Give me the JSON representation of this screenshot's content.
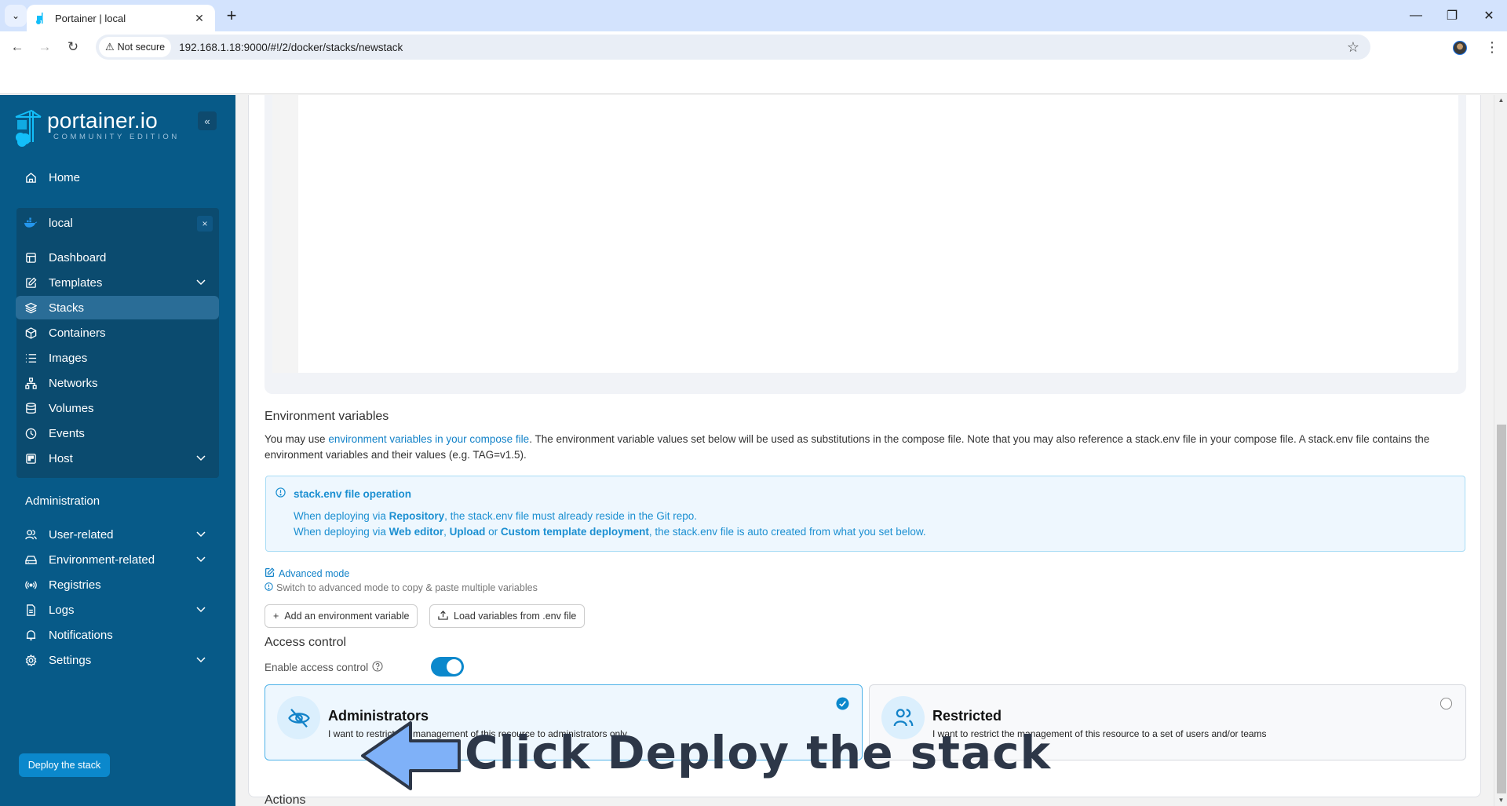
{
  "browser": {
    "tab_title": "Portainer | local",
    "new_tab": "+",
    "security_chip": "Not secure",
    "url": "192.168.1.18:9000/#!/2/docker/stacks/newstack"
  },
  "sidebar": {
    "logo_main": "portainer.io",
    "logo_sub": "COMMUNITY EDITION",
    "collapse": "«",
    "home": "Home",
    "environment": {
      "name": "local",
      "close": "×",
      "items": [
        {
          "label": "Dashboard",
          "icon": "dashboard-icon",
          "expandable": false,
          "active": false
        },
        {
          "label": "Templates",
          "icon": "edit-icon",
          "expandable": true,
          "active": false
        },
        {
          "label": "Stacks",
          "icon": "layers-icon",
          "expandable": false,
          "active": true
        },
        {
          "label": "Containers",
          "icon": "box-icon",
          "expandable": false,
          "active": false
        },
        {
          "label": "Images",
          "icon": "list-icon",
          "expandable": false,
          "active": false
        },
        {
          "label": "Networks",
          "icon": "network-icon",
          "expandable": false,
          "active": false
        },
        {
          "label": "Volumes",
          "icon": "database-icon",
          "expandable": false,
          "active": false
        },
        {
          "label": "Events",
          "icon": "clock-icon",
          "expandable": false,
          "active": false
        },
        {
          "label": "Host",
          "icon": "host-icon",
          "expandable": true,
          "active": false
        }
      ]
    },
    "administration": {
      "title": "Administration",
      "items": [
        {
          "label": "User-related",
          "icon": "users-icon",
          "expandable": true
        },
        {
          "label": "Environment-related",
          "icon": "hard-drive-icon",
          "expandable": true
        },
        {
          "label": "Registries",
          "icon": "radio-icon",
          "expandable": false
        },
        {
          "label": "Logs",
          "icon": "file-text-icon",
          "expandable": true
        },
        {
          "label": "Notifications",
          "icon": "bell-icon",
          "expandable": false
        },
        {
          "label": "Settings",
          "icon": "gear-icon",
          "expandable": true
        }
      ]
    }
  },
  "env_vars": {
    "title": "Environment variables",
    "desc_prefix": "You may use ",
    "desc_link": "environment variables in your compose file",
    "desc_suffix": ". The environment variable values set below will be used as substitutions in the compose file. Note that you may also reference a stack.env file in your compose file. A stack.env file contains the environment variables and their values (e.g. TAG=v1.5).",
    "info": {
      "title": "stack.env file operation",
      "line1": {
        "a": "When deploying via ",
        "b": "Repository",
        "c": ", the stack.env file must already reside in the Git repo."
      },
      "line2": {
        "a": "When deploying via ",
        "b": "Web editor",
        "c": ", ",
        "d": "Upload",
        "e": " or ",
        "f": "Custom template deployment",
        "g": ", the stack.env file is auto created from what you set below."
      }
    },
    "advanced_mode": "Advanced mode",
    "advanced_hint": "Switch to advanced mode to copy & paste multiple variables",
    "add_button": "Add an environment variable",
    "load_button": "Load variables from .env file"
  },
  "access_control": {
    "title": "Access control",
    "toggle_label": "Enable access control",
    "enabled": true,
    "options": [
      {
        "title": "Administrators",
        "desc": "I want to restrict the management of this resource to administrators only",
        "selected": true
      },
      {
        "title": "Restricted",
        "desc": "I want to restrict the management of this resource to a set of users and/or teams",
        "selected": false
      }
    ]
  },
  "actions": {
    "title": "Actions",
    "deploy_button": "Deploy the stack"
  },
  "annotation": {
    "text": "Click Deploy the stack",
    "arrow_color": "#7fb1f8"
  },
  "colors": {
    "sidebar_bg": "#075a88",
    "primary": "#0b88cc",
    "link": "#1282c8"
  }
}
